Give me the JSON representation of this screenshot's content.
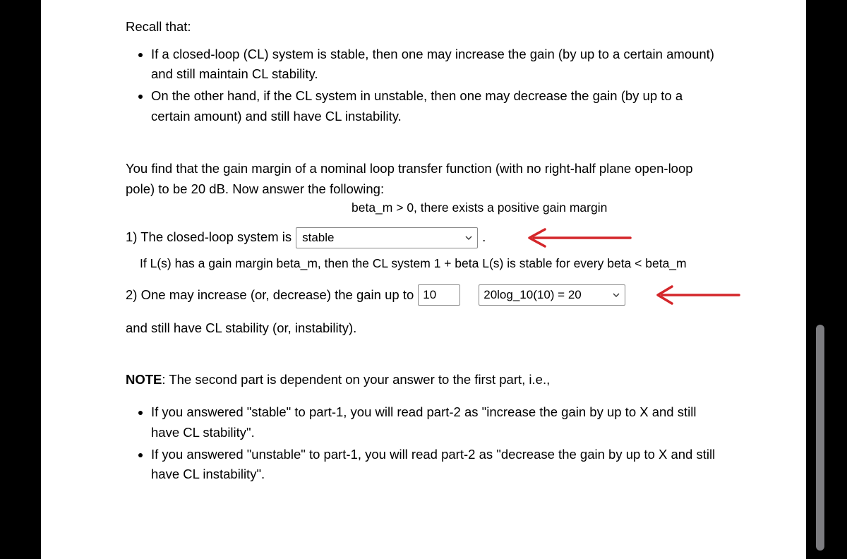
{
  "recall_heading": "Recall that:",
  "recall_items": [
    "If a closed-loop (CL) system is stable, then one may increase the gain (by up to a certain amount) and still maintain CL stability.",
    "On the other hand, if the CL system in unstable, then one may decrease the gain (by up to a certain amount) and still have CL instability."
  ],
  "intro_text": "You find that the gain margin of a nominal loop transfer function (with no right-half plane open-loop pole) to be 20 dB. Now answer the following:",
  "annotation_top": "beta_m > 0, there exists a positive gain margin",
  "q1_prefix": "1) The closed-loop system is",
  "q1_select_value": "stable",
  "q1_suffix": ".",
  "annotation_below_q1": "If L(s) has a gain margin beta_m, then the CL system 1 + beta L(s) is stable for every beta < beta_m",
  "q2_prefix": "2) One may increase (or, decrease) the gain up to",
  "q2_input_value": "10",
  "q2_select_value": "20log_10(10) = 20",
  "q2_after": "and still have CL stability (or, instability).",
  "note_lead": "NOTE",
  "note_rest": ": The second part is dependent on your answer to the first part, i.e.,",
  "note_items": [
    "If you answered \"stable\" to part-1, you will read part-2 as \"increase the gain by up to X and still have CL stability\".",
    "If you answered \"unstable\" to part-1, you will read part-2 as \"decrease the gain by up to X and still have CL instability\"."
  ]
}
